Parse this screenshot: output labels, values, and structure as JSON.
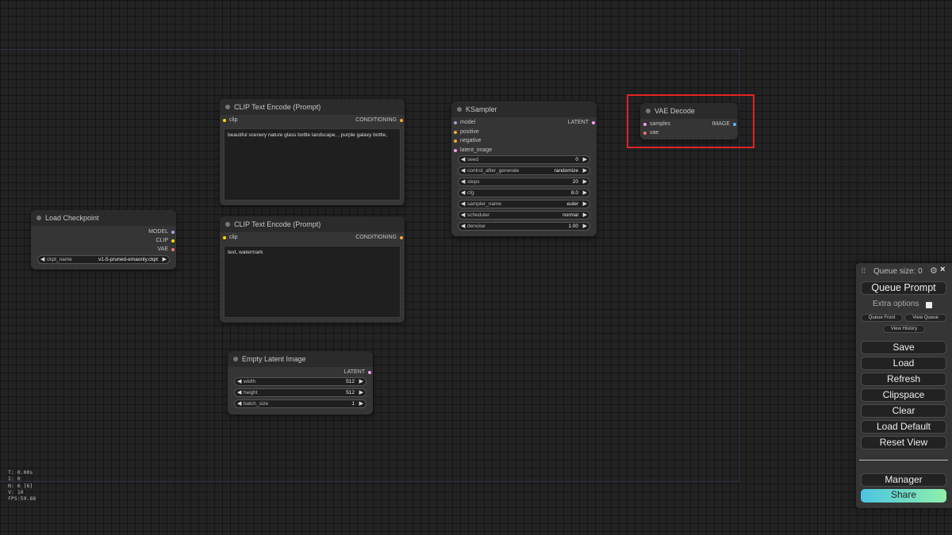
{
  "colors": {
    "model_slot": "#b39ddb",
    "clip_slot": "#ffd500",
    "vae_slot": "#ff6e6e",
    "conditioning_slot": "#ffa931",
    "latent_slot": "#ff9cf9",
    "image_slot": "#64b5f6",
    "highlight": "#e02424"
  },
  "nodes": {
    "load_checkpoint": {
      "title": "Load Checkpoint",
      "outputs": [
        "MODEL",
        "CLIP",
        "VAE"
      ],
      "ckpt_name_label": "ckpt_name",
      "ckpt_name_value": "v1-5-pruned-emaonly.ckpt"
    },
    "clip_pos": {
      "title": "CLIP Text Encode (Prompt)",
      "input": "clip",
      "output": "CONDITIONING",
      "text": "beautiful scenery nature glass bottle landscape, , purple galaxy bottle,"
    },
    "clip_neg": {
      "title": "CLIP Text Encode (Prompt)",
      "input": "clip",
      "output": "CONDITIONING",
      "text": "text, watermark"
    },
    "empty_latent": {
      "title": "Empty Latent Image",
      "output": "LATENT",
      "widgets": [
        {
          "label": "width",
          "value": "512"
        },
        {
          "label": "height",
          "value": "512"
        },
        {
          "label": "batch_size",
          "value": "1"
        }
      ]
    },
    "ksampler": {
      "title": "KSampler",
      "inputs": [
        "model",
        "positive",
        "negative",
        "latent_image"
      ],
      "output": "LATENT",
      "widgets": [
        {
          "label": "seed",
          "value": "0"
        },
        {
          "label": "control_after_generate",
          "value": "randomize"
        },
        {
          "label": "steps",
          "value": "20"
        },
        {
          "label": "cfg",
          "value": "8.0"
        },
        {
          "label": "sampler_name",
          "value": "euler"
        },
        {
          "label": "scheduler",
          "value": "normal"
        },
        {
          "label": "denoise",
          "value": "1.00"
        }
      ]
    },
    "vae_decode": {
      "title": "VAE Decode",
      "inputs": [
        "samples",
        "vae"
      ],
      "output": "IMAGE"
    }
  },
  "stats": [
    "T: 0.00s",
    "I: 0",
    "N: 6 [6]",
    "V: 10",
    "FPS:59.88"
  ],
  "menu": {
    "queue_size": "Queue size: 0",
    "queue_prompt": "Queue Prompt",
    "extra_options": "Extra options",
    "queue_front": "Queue Front",
    "view_queue": "View Queue",
    "view_history": "View History",
    "save": "Save",
    "load": "Load",
    "refresh": "Refresh",
    "clipspace": "Clipspace",
    "clear": "Clear",
    "load_default": "Load Default",
    "reset_view": "Reset View",
    "manager": "Manager",
    "share": "Share",
    "drag_icon": "drag-handle-icon",
    "gear_icon": "gear-icon",
    "close_icon": "close-icon"
  }
}
